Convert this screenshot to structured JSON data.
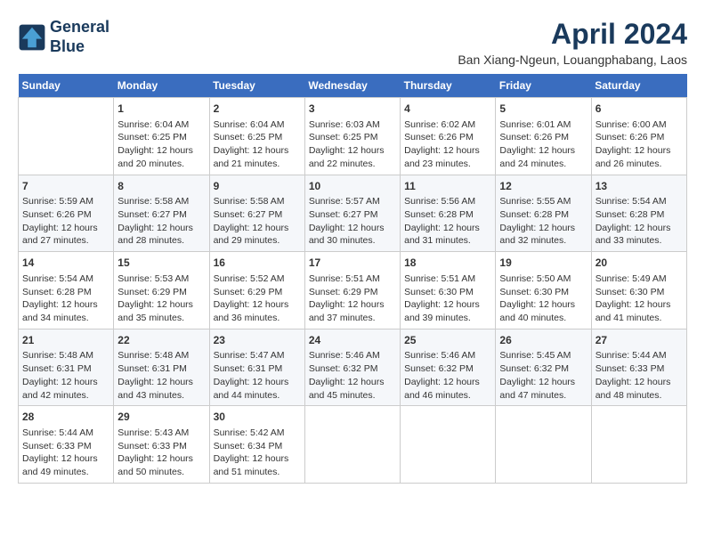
{
  "header": {
    "logo_line1": "General",
    "logo_line2": "Blue",
    "month": "April 2024",
    "location": "Ban Xiang-Ngeun, Louangphabang, Laos"
  },
  "days_of_week": [
    "Sunday",
    "Monday",
    "Tuesday",
    "Wednesday",
    "Thursday",
    "Friday",
    "Saturday"
  ],
  "weeks": [
    [
      {
        "day": "",
        "content": ""
      },
      {
        "day": "1",
        "content": "Sunrise: 6:04 AM\nSunset: 6:25 PM\nDaylight: 12 hours\nand 20 minutes."
      },
      {
        "day": "2",
        "content": "Sunrise: 6:04 AM\nSunset: 6:25 PM\nDaylight: 12 hours\nand 21 minutes."
      },
      {
        "day": "3",
        "content": "Sunrise: 6:03 AM\nSunset: 6:25 PM\nDaylight: 12 hours\nand 22 minutes."
      },
      {
        "day": "4",
        "content": "Sunrise: 6:02 AM\nSunset: 6:26 PM\nDaylight: 12 hours\nand 23 minutes."
      },
      {
        "day": "5",
        "content": "Sunrise: 6:01 AM\nSunset: 6:26 PM\nDaylight: 12 hours\nand 24 minutes."
      },
      {
        "day": "6",
        "content": "Sunrise: 6:00 AM\nSunset: 6:26 PM\nDaylight: 12 hours\nand 26 minutes."
      }
    ],
    [
      {
        "day": "7",
        "content": "Sunrise: 5:59 AM\nSunset: 6:26 PM\nDaylight: 12 hours\nand 27 minutes."
      },
      {
        "day": "8",
        "content": "Sunrise: 5:58 AM\nSunset: 6:27 PM\nDaylight: 12 hours\nand 28 minutes."
      },
      {
        "day": "9",
        "content": "Sunrise: 5:58 AM\nSunset: 6:27 PM\nDaylight: 12 hours\nand 29 minutes."
      },
      {
        "day": "10",
        "content": "Sunrise: 5:57 AM\nSunset: 6:27 PM\nDaylight: 12 hours\nand 30 minutes."
      },
      {
        "day": "11",
        "content": "Sunrise: 5:56 AM\nSunset: 6:28 PM\nDaylight: 12 hours\nand 31 minutes."
      },
      {
        "day": "12",
        "content": "Sunrise: 5:55 AM\nSunset: 6:28 PM\nDaylight: 12 hours\nand 32 minutes."
      },
      {
        "day": "13",
        "content": "Sunrise: 5:54 AM\nSunset: 6:28 PM\nDaylight: 12 hours\nand 33 minutes."
      }
    ],
    [
      {
        "day": "14",
        "content": "Sunrise: 5:54 AM\nSunset: 6:28 PM\nDaylight: 12 hours\nand 34 minutes."
      },
      {
        "day": "15",
        "content": "Sunrise: 5:53 AM\nSunset: 6:29 PM\nDaylight: 12 hours\nand 35 minutes."
      },
      {
        "day": "16",
        "content": "Sunrise: 5:52 AM\nSunset: 6:29 PM\nDaylight: 12 hours\nand 36 minutes."
      },
      {
        "day": "17",
        "content": "Sunrise: 5:51 AM\nSunset: 6:29 PM\nDaylight: 12 hours\nand 37 minutes."
      },
      {
        "day": "18",
        "content": "Sunrise: 5:51 AM\nSunset: 6:30 PM\nDaylight: 12 hours\nand 39 minutes."
      },
      {
        "day": "19",
        "content": "Sunrise: 5:50 AM\nSunset: 6:30 PM\nDaylight: 12 hours\nand 40 minutes."
      },
      {
        "day": "20",
        "content": "Sunrise: 5:49 AM\nSunset: 6:30 PM\nDaylight: 12 hours\nand 41 minutes."
      }
    ],
    [
      {
        "day": "21",
        "content": "Sunrise: 5:48 AM\nSunset: 6:31 PM\nDaylight: 12 hours\nand 42 minutes."
      },
      {
        "day": "22",
        "content": "Sunrise: 5:48 AM\nSunset: 6:31 PM\nDaylight: 12 hours\nand 43 minutes."
      },
      {
        "day": "23",
        "content": "Sunrise: 5:47 AM\nSunset: 6:31 PM\nDaylight: 12 hours\nand 44 minutes."
      },
      {
        "day": "24",
        "content": "Sunrise: 5:46 AM\nSunset: 6:32 PM\nDaylight: 12 hours\nand 45 minutes."
      },
      {
        "day": "25",
        "content": "Sunrise: 5:46 AM\nSunset: 6:32 PM\nDaylight: 12 hours\nand 46 minutes."
      },
      {
        "day": "26",
        "content": "Sunrise: 5:45 AM\nSunset: 6:32 PM\nDaylight: 12 hours\nand 47 minutes."
      },
      {
        "day": "27",
        "content": "Sunrise: 5:44 AM\nSunset: 6:33 PM\nDaylight: 12 hours\nand 48 minutes."
      }
    ],
    [
      {
        "day": "28",
        "content": "Sunrise: 5:44 AM\nSunset: 6:33 PM\nDaylight: 12 hours\nand 49 minutes."
      },
      {
        "day": "29",
        "content": "Sunrise: 5:43 AM\nSunset: 6:33 PM\nDaylight: 12 hours\nand 50 minutes."
      },
      {
        "day": "30",
        "content": "Sunrise: 5:42 AM\nSunset: 6:34 PM\nDaylight: 12 hours\nand 51 minutes."
      },
      {
        "day": "",
        "content": ""
      },
      {
        "day": "",
        "content": ""
      },
      {
        "day": "",
        "content": ""
      },
      {
        "day": "",
        "content": ""
      }
    ]
  ]
}
